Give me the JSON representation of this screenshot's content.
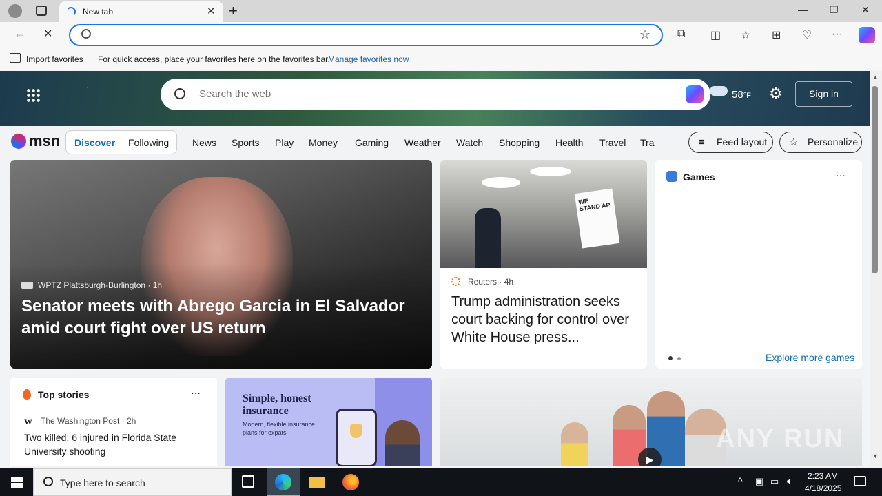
{
  "browser": {
    "tab_title": "New tab",
    "favorites_bar": {
      "import_label": "Import favorites",
      "hint": "For quick access, place your favorites here on the favorites bar.",
      "manage_link": "Manage favorites now"
    }
  },
  "msn": {
    "search_placeholder": "Search the web",
    "weather_temp": "58",
    "weather_unit": "°F",
    "sign_in": "Sign in",
    "logo_text": "msn",
    "tabs": {
      "discover": "Discover",
      "following": "Following"
    },
    "nav": [
      "News",
      "Sports",
      "Play",
      "Money",
      "Gaming",
      "Weather",
      "Watch",
      "Shopping",
      "Health",
      "Travel",
      "Trat"
    ],
    "feed_layout": "Feed layout",
    "personalize": "Personalize",
    "hero_story": {
      "source": "WPTZ Plattsburgh-Burlington",
      "age": "1h",
      "headline": "Senator meets with Abrego Garcia in El Salvador amid court fight over US return"
    },
    "reuters_story": {
      "source": "Reuters",
      "age": "4h",
      "headline": "Trump administration seeks court backing for control over White House press..."
    },
    "games": {
      "title": "Games",
      "explore": "Explore more games"
    },
    "top_stories": {
      "title": "Top stories",
      "items": [
        {
          "source": "The Washington Post",
          "age": "2h",
          "headline": "Two killed, 6 injured in Florida State University shooting"
        }
      ]
    },
    "ad": {
      "title": "Simple, honest insurance",
      "subtitle": "Modern, flexible insurance plans for expats"
    },
    "sign_text": "WE STAND AP"
  },
  "taskbar": {
    "search_placeholder": "Type here to search",
    "time": "2:23 AM",
    "date": "4/18/2025"
  },
  "watermark": "ANY RUN"
}
